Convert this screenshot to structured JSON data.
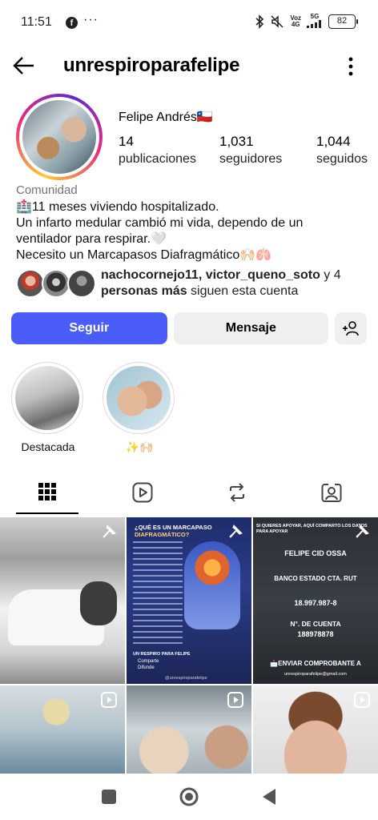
{
  "status_bar": {
    "time": "11:51",
    "facebook_glyph": "f",
    "more_dots": "···",
    "network_top": "Voz",
    "network_bottom": "4G",
    "signal_label": "5G",
    "battery": "82"
  },
  "header": {
    "username": "unrespiroparafelipe"
  },
  "profile": {
    "display_name": "Felipe Andrés🇨🇱",
    "stats": [
      {
        "value": "14",
        "label": "publicaciones"
      },
      {
        "value": "1,031",
        "label": "seguidores"
      },
      {
        "value": "1,044",
        "label": "seguidos"
      }
    ],
    "category": "Comunidad",
    "bio_lines": [
      "🏥11 meses viviendo hospitalizado.",
      "Un infarto medular cambió mi vida, dependo de un",
      "ventilador para respirar.🤍",
      "Necesito un Marcapasos Diafragmático🙌🏻🫁"
    ],
    "followed_by_names": "nachocornejo11, victor_queno_soto",
    "followed_by_rest": " y 4",
    "followed_by_more": "personas más",
    "followed_by_suffix": " siguen esta cuenta"
  },
  "actions": {
    "follow_label": "Seguir",
    "message_label": "Mensaje"
  },
  "highlights": [
    {
      "label": "Destacada"
    },
    {
      "label": "✨🙌🏻"
    }
  ],
  "tabs": [
    "grid-icon",
    "reels-icon",
    "reposts-icon",
    "tagged-icon"
  ],
  "grid": [
    {
      "type": "pinned",
      "desc": "hospital"
    },
    {
      "type": "pinned",
      "title_line1": "¿QUÉ ES UN MARCAPASO",
      "title_line2": "DIAFRAGMÁTICO?",
      "footer": "@unrespiroparafelipe",
      "apoyar_header": "UN RESPIRO PARA FELIPE",
      "list": [
        "Comparte",
        "Difunde"
      ]
    },
    {
      "type": "pinned",
      "header": "SI QUIERES APOYAR, AQUÍ COMPARTO LOS DATOS PARA APOYAR",
      "name": "FELIPE CID OSSA",
      "bank": "BANCO ESTADO CTA. RUT",
      "rut": "18.997.987-8",
      "account_label": "N°. DE CUENTA",
      "account": "188978878",
      "send_label": "📩ENVIAR COMPROBANTE A",
      "email": "unrespiroparafelipe@gmail.com"
    }
  ],
  "colors": {
    "follow_button": "#4a5df9",
    "secondary_button": "#efefef",
    "category_text": "#737373"
  }
}
